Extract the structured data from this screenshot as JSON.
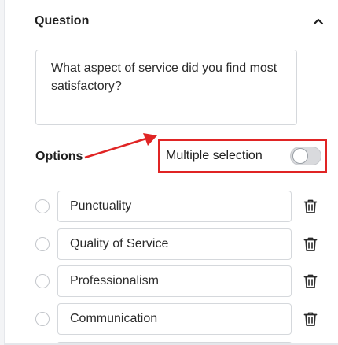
{
  "question_section": {
    "title": "Question",
    "collapse_icon": "chevron-up-icon",
    "question_text": "What aspect of service did you find most satisfactory?"
  },
  "options_section": {
    "title": "Options",
    "multiple_selection": {
      "label": "Multiple selection",
      "enabled": false
    },
    "options": [
      {
        "label": "Punctuality"
      },
      {
        "label": "Quality of Service"
      },
      {
        "label": "Professionalism"
      },
      {
        "label": "Communication"
      }
    ],
    "delete_icon": "trash-icon"
  },
  "colors": {
    "highlight": "#e02424",
    "border": "#d5d8dc",
    "toggle_off": "#d9dadd"
  }
}
